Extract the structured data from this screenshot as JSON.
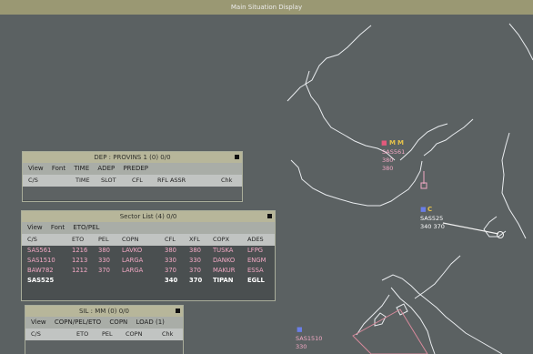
{
  "window_title": "Main Situation Display",
  "dep_window": {
    "title": "DEP : PROVINS 1  (0) 0/0",
    "menu": [
      "View",
      "Font",
      "TIME",
      "ADEP",
      "PREDEP"
    ],
    "columns": [
      "C/S",
      "TIME",
      "SLOT",
      "CFL",
      "RFL ASSR",
      "Chk"
    ]
  },
  "sector_list": {
    "title": "Sector List (4) 0/0",
    "menu": [
      "View",
      "Font",
      "ETO/PEL"
    ],
    "columns": [
      "C/S",
      "ETO",
      "PEL",
      "COPN",
      "CFL",
      "XFL",
      "COPX",
      "ADES"
    ],
    "rows": [
      {
        "cs": "SAS561",
        "eto": "1216",
        "pel": "380",
        "copn": "LAVKO",
        "cfl": "380",
        "xfl": "380",
        "copx": "TUSKA",
        "ades": "LFPG",
        "style": "pink"
      },
      {
        "cs": "SAS1510",
        "eto": "1213",
        "pel": "330",
        "copn": "LARGA",
        "cfl": "330",
        "xfl": "330",
        "copx": "DANKO",
        "ades": "ENGM",
        "style": "pink"
      },
      {
        "cs": "BAW782",
        "eto": "1212",
        "pel": "370",
        "copn": "LARGA",
        "cfl": "370",
        "xfl": "370",
        "copx": "MAKUR",
        "ades": "ESSA",
        "style": "pink"
      },
      {
        "cs": "SAS525",
        "eto": "",
        "pel": "",
        "copn": "",
        "cfl": "340",
        "xfl": "370",
        "copx": "TIPAN",
        "ades": "EGLL",
        "style": "white"
      }
    ]
  },
  "sil_window": {
    "title": "SIL : MM  (0) 0/0",
    "menu": [
      "View",
      "COPN/PEL/ETO",
      "COPN",
      "LOAD (1)"
    ],
    "columns": [
      "C/S",
      "ETO",
      "PEL",
      "COPN",
      "Chk"
    ]
  },
  "tracks": {
    "sas561": {
      "flag": "M",
      "callsign": "SAS561",
      "line2": "380",
      "line3": "380"
    },
    "sas525": {
      "flag": "C",
      "callsign": "SAS525",
      "line2": "340  370"
    },
    "sas1510": {
      "callsign": "SAS1510",
      "line2": "330"
    }
  },
  "colors": {
    "background": "#5b6162",
    "pink": "#f2a9c4",
    "titlebar": "#9a9873",
    "panel_title": "#b7b69a"
  }
}
